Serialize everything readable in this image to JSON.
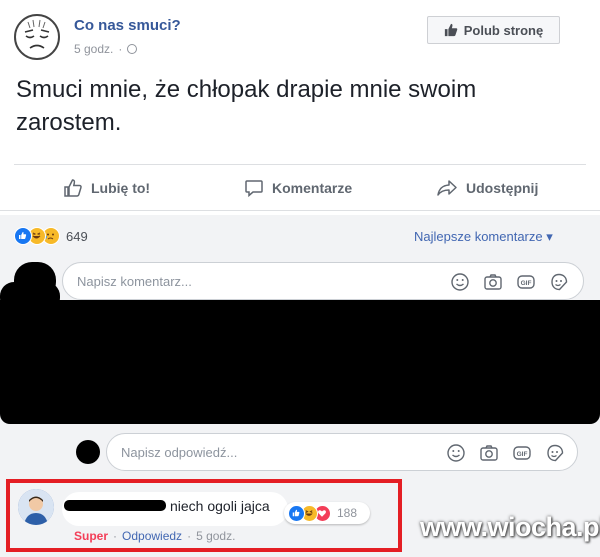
{
  "post": {
    "page_name": "Co nas smuci?",
    "time": "5 godz.",
    "like_page_label": "Polub stronę",
    "text": "Smuci mnie, że chłopak drapie mnie swoim zarostem."
  },
  "actions": {
    "like_label": "Lubię to!",
    "comment_label": "Komentarze",
    "share_label": "Udostępnij"
  },
  "reactions": {
    "types": [
      "like",
      "haha",
      "sad"
    ],
    "count": "649"
  },
  "comments_header": {
    "sort_label": "Najlepsze komentarze ▾"
  },
  "comment_input": {
    "placeholder": "Napisz komentarz..."
  },
  "reply_input": {
    "placeholder": "Napisz odpowiedź..."
  },
  "comment": {
    "text": "niech ogoli jajca",
    "reaction_types": [
      "like",
      "haha",
      "love"
    ],
    "reaction_count": "188",
    "action_super": "Super",
    "action_reply": "Odpowiedz",
    "time": "5 godz.",
    "separator": "·"
  },
  "watermark": "www.wiocha.pl",
  "colors": {
    "link_blue": "#365899",
    "fb_blue": "#1877f2",
    "highlight_red": "#e41e24",
    "reaction_yellow": "#f7b928",
    "love_red": "#f33e58"
  }
}
